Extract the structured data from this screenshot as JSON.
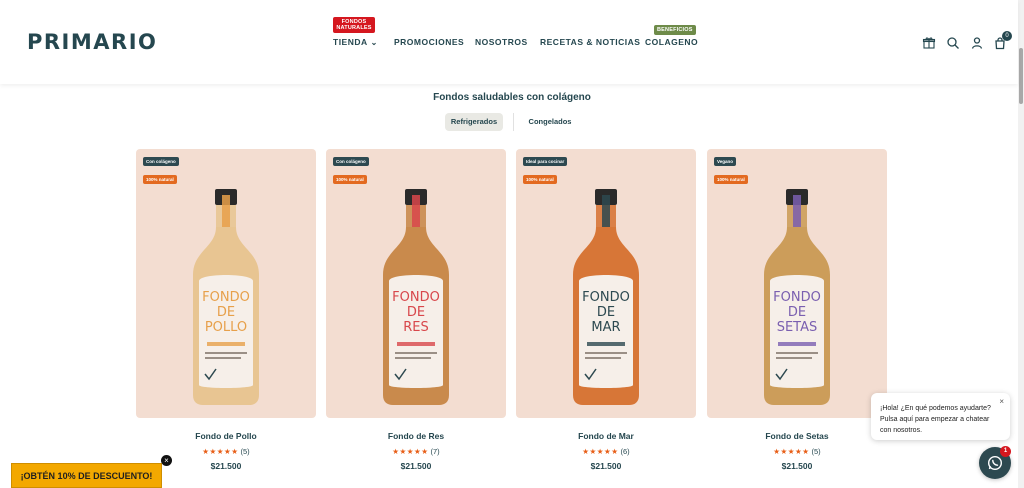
{
  "header": {
    "logo": "PRIMARIO",
    "nav": [
      {
        "label": "TIENDA",
        "badge": "FONDOS NATURALES"
      },
      {
        "label": "PROMOCIONES"
      },
      {
        "label": "NOSOTROS"
      },
      {
        "label": "RECETAS & NOTICIAS"
      },
      {
        "label": "COLAGENO",
        "badge": "BENEFICIOS"
      }
    ],
    "icons": [
      "gift-icon",
      "search-icon",
      "user-icon",
      "cart-icon"
    ],
    "cart_count": "0"
  },
  "section": {
    "title": "Fondos saludables con colágeno",
    "tabs": [
      {
        "label": "Refrigerados",
        "active": true
      },
      {
        "label": "Congelados",
        "active": false
      }
    ]
  },
  "products": [
    {
      "name": "Fondo de Pollo",
      "tag1": "Con colágeno",
      "tag2": "100% natural",
      "stars": "★★★★★",
      "reviews": "(5)",
      "price": "$21.500",
      "label": "FONDO DE POLLO",
      "liquid": "#e8c592",
      "accent": "#e7a04a"
    },
    {
      "name": "Fondo de Res",
      "tag1": "Con colágeno",
      "tag2": "100% natural",
      "stars": "★★★★★",
      "reviews": "(7)",
      "price": "$21.500",
      "label": "FONDO DE RES",
      "liquid": "#c98a4c",
      "accent": "#d8474b"
    },
    {
      "name": "Fondo de Mar",
      "tag1": "Ideal para cocinar",
      "tag2": "100% natural",
      "stars": "★★★★★",
      "reviews": "(6)",
      "price": "$21.500",
      "label": "FONDO DE MAR",
      "liquid": "#d77637",
      "accent": "#2d4950"
    },
    {
      "name": "Fondo de Setas",
      "tag1": "Vegano",
      "tag2": "100% natural",
      "stars": "★★★★★",
      "reviews": "(5)",
      "price": "$21.500",
      "label": "FONDO DE SETAS",
      "liquid": "#cc9d5a",
      "accent": "#7a5fb0"
    }
  ],
  "chat": {
    "message": "¡Hola! ¿En qué podemos ayudarte? Pulsa aquí para empezar a chatear con nosotros.",
    "close": "×",
    "unread": "1"
  },
  "promo": {
    "label": "¡OBTÉN 10% DE DESCUENTO!",
    "close": "×"
  }
}
